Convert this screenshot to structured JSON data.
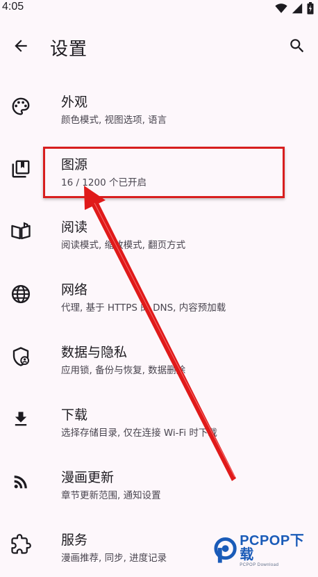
{
  "status_bar": {
    "time": "4:05",
    "icons": [
      "wifi-icon",
      "signal-icon",
      "battery-icon"
    ]
  },
  "app_bar": {
    "title": "设置",
    "back_icon": "arrow-back-icon",
    "search_icon": "search-icon"
  },
  "settings": [
    {
      "id": "appearance",
      "title": "外观",
      "subtitle": "颜色模式, 视图选项, 语言",
      "icon": "palette-icon"
    },
    {
      "id": "sources",
      "title": "图源",
      "subtitle": "16 / 1200 个已开启",
      "icon": "library-icon"
    },
    {
      "id": "reader",
      "title": "阅读",
      "subtitle": "阅读模式, 缩放模式, 翻页方式",
      "icon": "book-open-icon"
    },
    {
      "id": "network",
      "title": "网络",
      "subtitle": "代理, 基于 HTTPS 的 DNS, 内容预加载",
      "icon": "globe-icon"
    },
    {
      "id": "privacy",
      "title": "数据与隐私",
      "subtitle": "应用锁, 备份与恢复, 数据删除",
      "icon": "shield-user-icon"
    },
    {
      "id": "downloads",
      "title": "下载",
      "subtitle": "选择存储目录, 仅在连接 Wi-Fi 时下载",
      "icon": "download-icon"
    },
    {
      "id": "updates",
      "title": "漫画更新",
      "subtitle": "章节更新范围, 通知设置",
      "icon": "rss-icon"
    },
    {
      "id": "services",
      "title": "服务",
      "subtitle": "漫画推荐, 同步, 进度记录",
      "icon": "puzzle-icon"
    }
  ],
  "annotation": {
    "highlight_color": "#d81e1e",
    "arrow_color": "#e01a1a"
  },
  "watermark": {
    "brand": "PCPOP下载",
    "sub": "PCPOP Download",
    "color": "#1a5bb8"
  }
}
